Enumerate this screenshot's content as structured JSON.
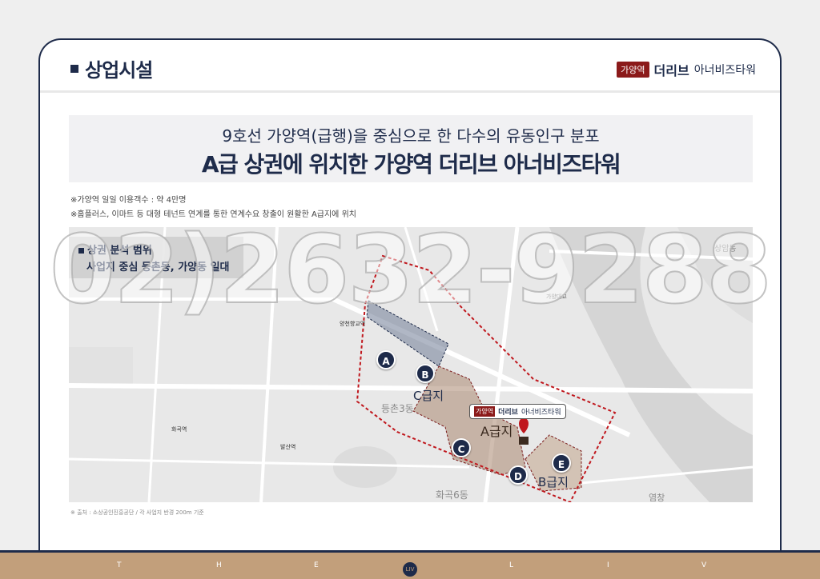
{
  "header": {
    "section_title": "상업시설",
    "brand_badge": "가양역",
    "brand_bold": "더리브",
    "brand_light": "아너비즈타워"
  },
  "headline": {
    "line1": "9호선 가양역(급행)을 중심으로 한 다수의 유동인구 분포",
    "line2": "A급 상권에 위치한 가양역 더리브 아너비즈타워"
  },
  "notes": [
    "※가양역 일일 이용객수 : 약 4만명",
    "※홈플러스, 이마트 등 대형 테넌트 연계를 통한 연계수요 창출이 원활한 A급지에 위치"
  ],
  "map": {
    "box_title": "상권 분석 범위",
    "box_desc": "사업지 중심 등촌동, 가양동 일대",
    "markers": [
      "A",
      "B",
      "C",
      "D",
      "E"
    ],
    "zones": {
      "a": "A급지",
      "b": "B급지",
      "c": "C급지"
    },
    "pin": {
      "badge": "가양역",
      "bold": "더리브",
      "light": "아너비즈타워"
    },
    "labels": {
      "deungchon3": "등촌3동",
      "hwagok6": "화곡6동",
      "gayangdaegyo": "가양대교",
      "sangamdong": "상암동",
      "gayangyeok": "양천향교역",
      "balsan": "발산역",
      "hwagok": "화곡역",
      "yeomchang": "염창"
    },
    "colors": {
      "zone_a": "#a9876f",
      "zone_b": "#c4aa93",
      "zone_c": "#6f7b95",
      "dash": "#c0171d"
    }
  },
  "source": "※ 출처 : 소상공인진흥공단 / 각 사업지 반경 200m 기준",
  "watermark": "02)2632-9288",
  "footer": {
    "letters": [
      "T",
      "H",
      "E",
      "L",
      "I",
      "V"
    ],
    "logo": "LIV"
  }
}
